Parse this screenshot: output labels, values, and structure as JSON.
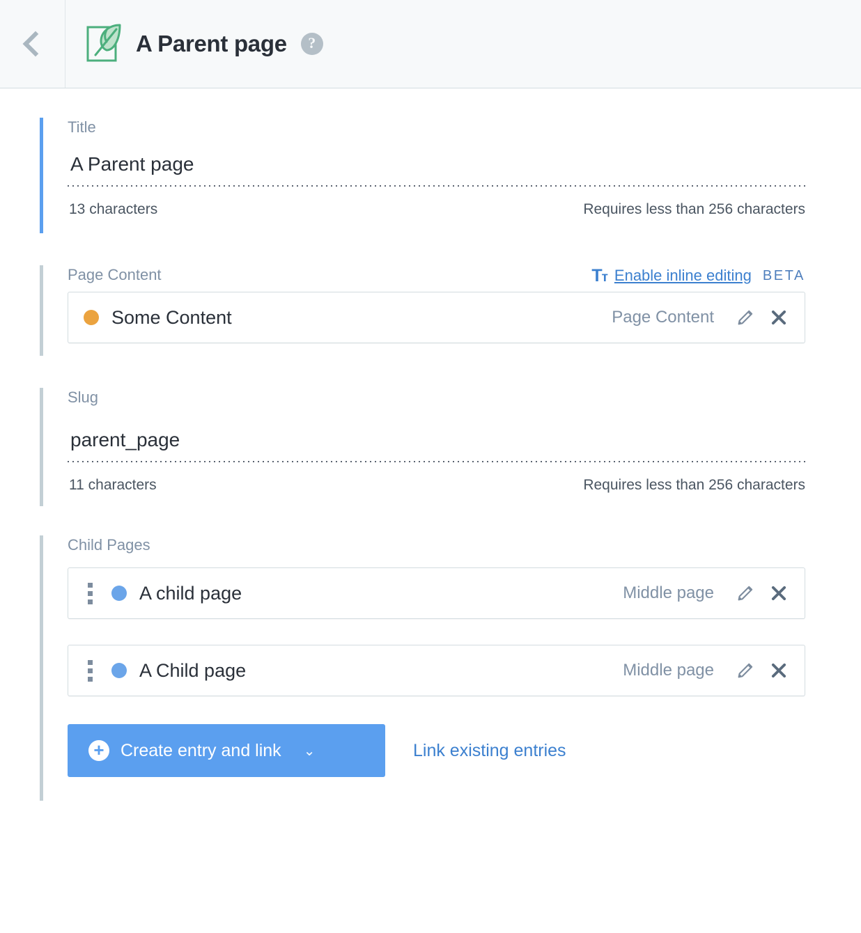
{
  "header": {
    "back_label": "Back",
    "back_icon": "chevron-left-icon",
    "content_type_icon": "leaf-document-icon",
    "title": "A Parent page",
    "help_icon": "question-mark-icon"
  },
  "colors": {
    "accent_active": "#5b9fef",
    "accent_inactive": "#c3cfd5",
    "link": "#3c80cf",
    "status_draft": "#eba33f",
    "status_published": "#6ba5e9",
    "content_type_green": "#4caf7d"
  },
  "fields": {
    "title": {
      "label": "Title",
      "value": "A Parent page",
      "placeholder": "",
      "char_count": "13 characters",
      "constraint": "Requires less than 256 characters"
    },
    "page_content": {
      "label": "Page Content",
      "inline_edit_icon": "text-format-icon",
      "inline_edit_label": "Enable inline editing",
      "beta_label": "BETA",
      "entries": [
        {
          "status_dot": "draft",
          "title": "Some Content",
          "content_type": "Page Content",
          "edit_icon": "pencil-icon",
          "remove_icon": "close-icon"
        }
      ]
    },
    "slug": {
      "label": "Slug",
      "value": "parent_page",
      "placeholder": "",
      "char_count": "11 characters",
      "constraint": "Requires less than 256 characters"
    },
    "child_pages": {
      "label": "Child Pages",
      "entries": [
        {
          "drag_icon": "drag-handle-icon",
          "status_dot": "published",
          "title": "A child page",
          "content_type": "Middle page",
          "edit_icon": "pencil-icon",
          "remove_icon": "close-icon"
        },
        {
          "drag_icon": "drag-handle-icon",
          "status_dot": "published",
          "title": "A Child page",
          "content_type": "Middle page",
          "edit_icon": "pencil-icon",
          "remove_icon": "close-icon"
        }
      ],
      "actions": {
        "create_icon": "plus-circle-icon",
        "create_label": "Create entry and link",
        "create_caret": "chevron-down-icon",
        "link_existing_label": "Link existing entries"
      }
    }
  }
}
